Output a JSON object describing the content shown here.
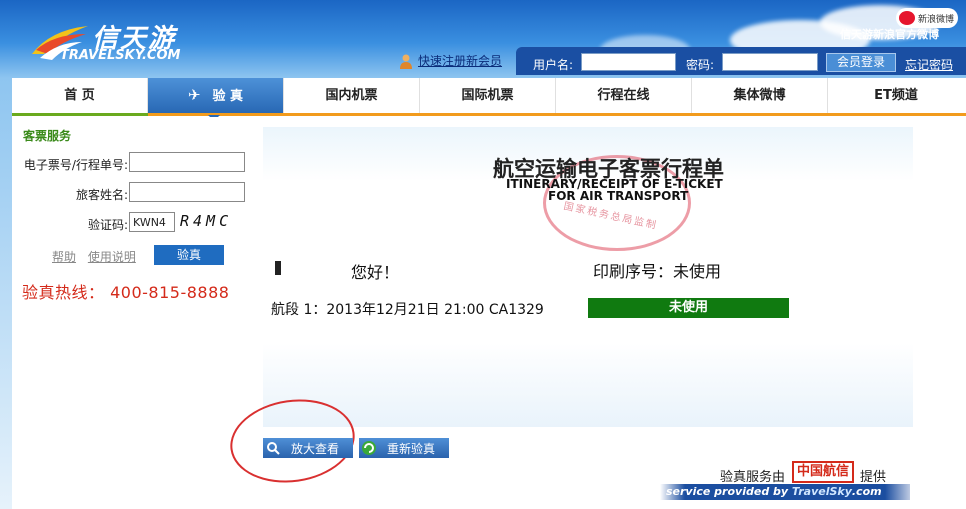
{
  "header": {
    "logo_cn": "信天游",
    "logo_en": "TRAVELSKY.COM",
    "weibo_badge": "新浪微博",
    "weibo_text": "信天游新浪官方微博",
    "register_link": "快速注册新会员",
    "username_label": "用户名:",
    "password_label": "密码:",
    "login_button": "会员登录",
    "forgot_link": "忘记密码"
  },
  "nav": {
    "items": [
      {
        "label": "首 页"
      },
      {
        "label": "验 真"
      },
      {
        "label": "国内机票"
      },
      {
        "label": "国际机票"
      },
      {
        "label": "行程在线"
      },
      {
        "label": "集体微博"
      },
      {
        "label": "ET频道"
      }
    ]
  },
  "side": {
    "title": "客票服务",
    "ticket_label": "电子票号/行程单号:",
    "ticket_value": "",
    "name_label": "旅客姓名:",
    "name_value": "",
    "captcha_label": "验证码:",
    "captcha_value": "KWN4",
    "captcha_image": "R4MC",
    "help_link": "帮助",
    "guide_link": "使用说明",
    "verify_button": "验真",
    "hotline": "验真热线： 400-815-8888"
  },
  "ticket": {
    "title_cn": "航空运输电子客票行程单",
    "title_en_1": "ITINERARY/RECEIPT OF E-TICKET",
    "title_en_2": "FOR AIR TRANSPORT",
    "seal_text": "国家税务总局监制",
    "greeting": "您好！",
    "serial_label": "印刷序号：未使用",
    "segment": "航段 1：2013年12月21日 21:00  CA1329",
    "status": "未使用"
  },
  "actions": {
    "zoom_button": "放大查看",
    "reverify_button": "重新验真"
  },
  "footer": {
    "service_by": "验真服务由",
    "china_logo": "中国航信",
    "provide": "提供",
    "service_provided_by": "service provided by",
    "travelsky": "TravelSky",
    "dotcom": ".com"
  }
}
